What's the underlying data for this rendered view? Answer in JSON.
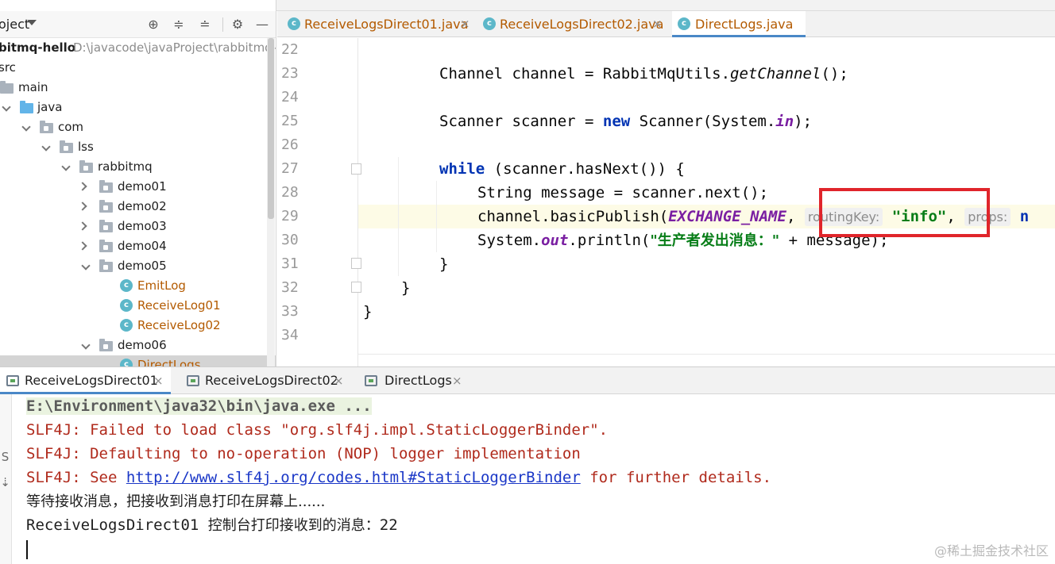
{
  "project_panel": {
    "title": "oject",
    "root": {
      "name": "bitmq-hello",
      "path": "D:\\javacode\\javaProject\\rabbitmq-"
    },
    "tree": [
      {
        "label": "src",
        "kind": "plain"
      },
      {
        "label": "main",
        "kind": "folder"
      },
      {
        "label": "java",
        "kind": "folder-blue"
      },
      {
        "label": "com",
        "kind": "package"
      },
      {
        "label": "lss",
        "kind": "package"
      },
      {
        "label": "rabbitmq",
        "kind": "package"
      },
      {
        "label": "demo01",
        "kind": "package"
      },
      {
        "label": "demo02",
        "kind": "package"
      },
      {
        "label": "demo03",
        "kind": "package"
      },
      {
        "label": "demo04",
        "kind": "package"
      },
      {
        "label": "demo05",
        "kind": "package"
      },
      {
        "label": "EmitLog",
        "kind": "class"
      },
      {
        "label": "ReceiveLog01",
        "kind": "class"
      },
      {
        "label": "ReceiveLog02",
        "kind": "class"
      },
      {
        "label": "demo06",
        "kind": "package"
      },
      {
        "label": "DirectLogs",
        "kind": "class"
      }
    ]
  },
  "editor": {
    "tabs": [
      {
        "label": "ReceiveLogsDirect01.java",
        "active": false
      },
      {
        "label": "ReceiveLogsDirect02.java",
        "active": false
      },
      {
        "label": "DirectLogs.java",
        "active": true
      }
    ],
    "tab_close": "×",
    "line_numbers": [
      "22",
      "23",
      "24",
      "25",
      "26",
      "27",
      "28",
      "29",
      "30",
      "31",
      "32",
      "33",
      "34"
    ],
    "code": {
      "l23_a": "Channel channel = RabbitMqUtils.",
      "l23_b": "getChannel",
      "l23_c": "();",
      "l25_a": "Scanner scanner = ",
      "l25_b": "new",
      "l25_c": " Scanner(System.",
      "l25_d": "in",
      "l25_e": ");",
      "l27_a": "while",
      "l27_b": " (scanner.hasNext()) {",
      "l28": "String message = scanner.next();",
      "l29_a": "channel.basicPublish(",
      "l29_b": "EXCHANGE_NAME",
      "l29_c": ", ",
      "l29_hint1": "routingKey:",
      "l29_str": "\"info\"",
      "l29_d": ", ",
      "l29_hint2": "props:",
      "l29_e": "n",
      "l30_a": "System.",
      "l30_b": "out",
      "l30_c": ".println(",
      "l30_str": "\"生产者发出消息：\"",
      "l30_d": " + message);",
      "l31": "}",
      "l32": "}",
      "l33": "}"
    }
  },
  "run_panel": {
    "tabs": [
      {
        "label": "ReceiveLogsDirect01",
        "active": true
      },
      {
        "label": "ReceiveLogsDirect02",
        "active": false
      },
      {
        "label": "DirectLogs",
        "active": false
      }
    ],
    "tab_close": "×",
    "console": {
      "cmd": "E:\\Environment\\java32\\bin\\java.exe ...",
      "err1": "SLF4J: Failed to load class \"org.slf4j.impl.StaticLoggerBinder\".",
      "err2": "SLF4J: Defaulting to no-operation (NOP) logger implementation",
      "err3_a": "SLF4J: See ",
      "err3_link": "http://www.slf4j.org/codes.html#StaticLoggerBinder",
      "err3_b": " for further details.",
      "wait": "等待接收消息，把接收到消息打印在屏幕上......",
      "recv_a": "ReceiveLogsDirect01 ",
      "recv_b": "控制台打印接收到的消息：",
      "recv_c": "22"
    },
    "side_glyphs": [
      "S",
      "⇣"
    ]
  },
  "watermark": "@稀土掘金技术社区",
  "colors": {
    "accent": "#4a88c7",
    "highlight_box": "#e0252b",
    "keyword": "#0033b3",
    "string": "#067d17",
    "error": "#b02a1c"
  }
}
